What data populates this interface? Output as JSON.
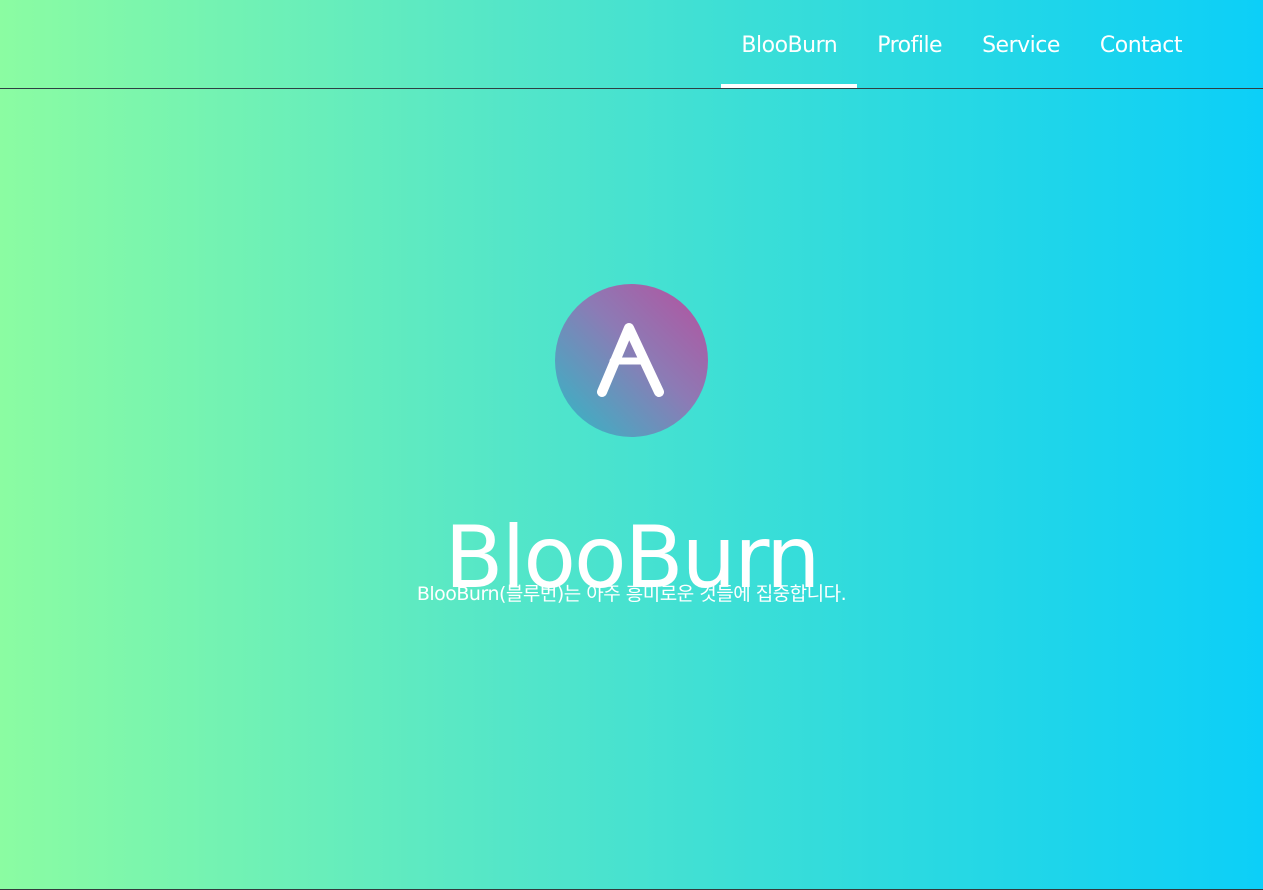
{
  "nav": {
    "items": [
      {
        "label": "BlooBurn",
        "active": true
      },
      {
        "label": "Profile",
        "active": false
      },
      {
        "label": "Service",
        "active": false
      },
      {
        "label": "Contact",
        "active": false
      }
    ]
  },
  "hero": {
    "logo_icon": "aave-a-logo-icon",
    "title": "BlooBurn",
    "subtitle": "BlooBurn(블루번)는 아주 흥미로운 것들에 집중합니다."
  },
  "colors": {
    "gradient_left": "#8bfca2",
    "gradient_right": "#0ccff8",
    "logo_gradient_top": "#b6509e",
    "logo_gradient_bottom": "#2ebac6",
    "text": "#ffffff"
  }
}
